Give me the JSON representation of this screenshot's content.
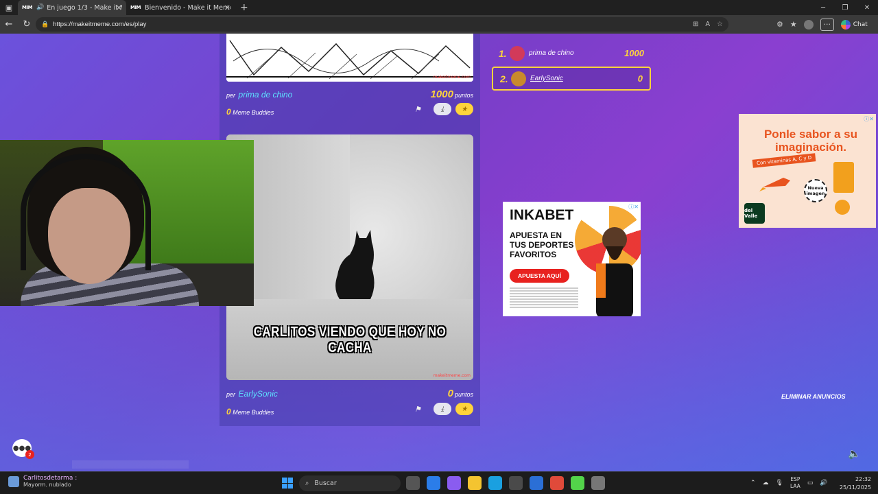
{
  "browser": {
    "tabs": [
      {
        "label": "En juego 1/3 - Make it Meme",
        "favicon": "MIM",
        "audio": true,
        "active": true
      },
      {
        "label": "Bienvenido - Make it Meme",
        "favicon": "MIM",
        "audio": false,
        "active": false
      }
    ],
    "url": "https://makeitmeme.com/es/play",
    "chat_label": "Chat"
  },
  "feed": {
    "entries": [
      {
        "per_label": "per",
        "author": "prima de chino",
        "points": "1000",
        "points_label": "puntos",
        "buddies": "0",
        "buddies_label": "Meme Buddies"
      },
      {
        "per_label": "per",
        "author": "EarlySonic",
        "points": "0",
        "points_label": "puntos",
        "buddies": "0",
        "buddies_label": "Meme Buddies",
        "caption": "CARLITOS VIENDO QUE HOY NO CACHA"
      }
    ],
    "watermark": "makeitmeme.com"
  },
  "scoreboard": [
    {
      "rank": "1.",
      "name": "prima de chino",
      "score": "1000",
      "avatar_color": "#d23a5a"
    },
    {
      "rank": "2.",
      "name": "EarlySonic",
      "score": "0",
      "avatar_color": "#c98a2c",
      "highlight": true
    }
  ],
  "ads": {
    "inkabet": {
      "brand": "INKABET",
      "headline": "APUESTA EN TUS DEPORTES FAVORITOS",
      "cta": "APUESTA AQUÍ"
    },
    "valle": {
      "headline": "Ponle sabor a su imaginación.",
      "tag": "Con vitaminas A, C y D",
      "badge": "Nueva imagen",
      "logo": "del Valle"
    }
  },
  "remove_ads": "ELIMINAR ANUNCIOS",
  "chat": {
    "unread": "2"
  },
  "taskbar": {
    "weather_title": "Carlitosdetarma :",
    "weather_sub": "Mayorm. nublado",
    "search": "Buscar",
    "lang_top": "ESP",
    "lang_bottom": "LAA",
    "time": "22:32",
    "date": "25/11/2025"
  },
  "colors": {
    "accent": "#ffd43b",
    "author": "#5ee0ff",
    "page_bg": "#7a3ec9"
  }
}
